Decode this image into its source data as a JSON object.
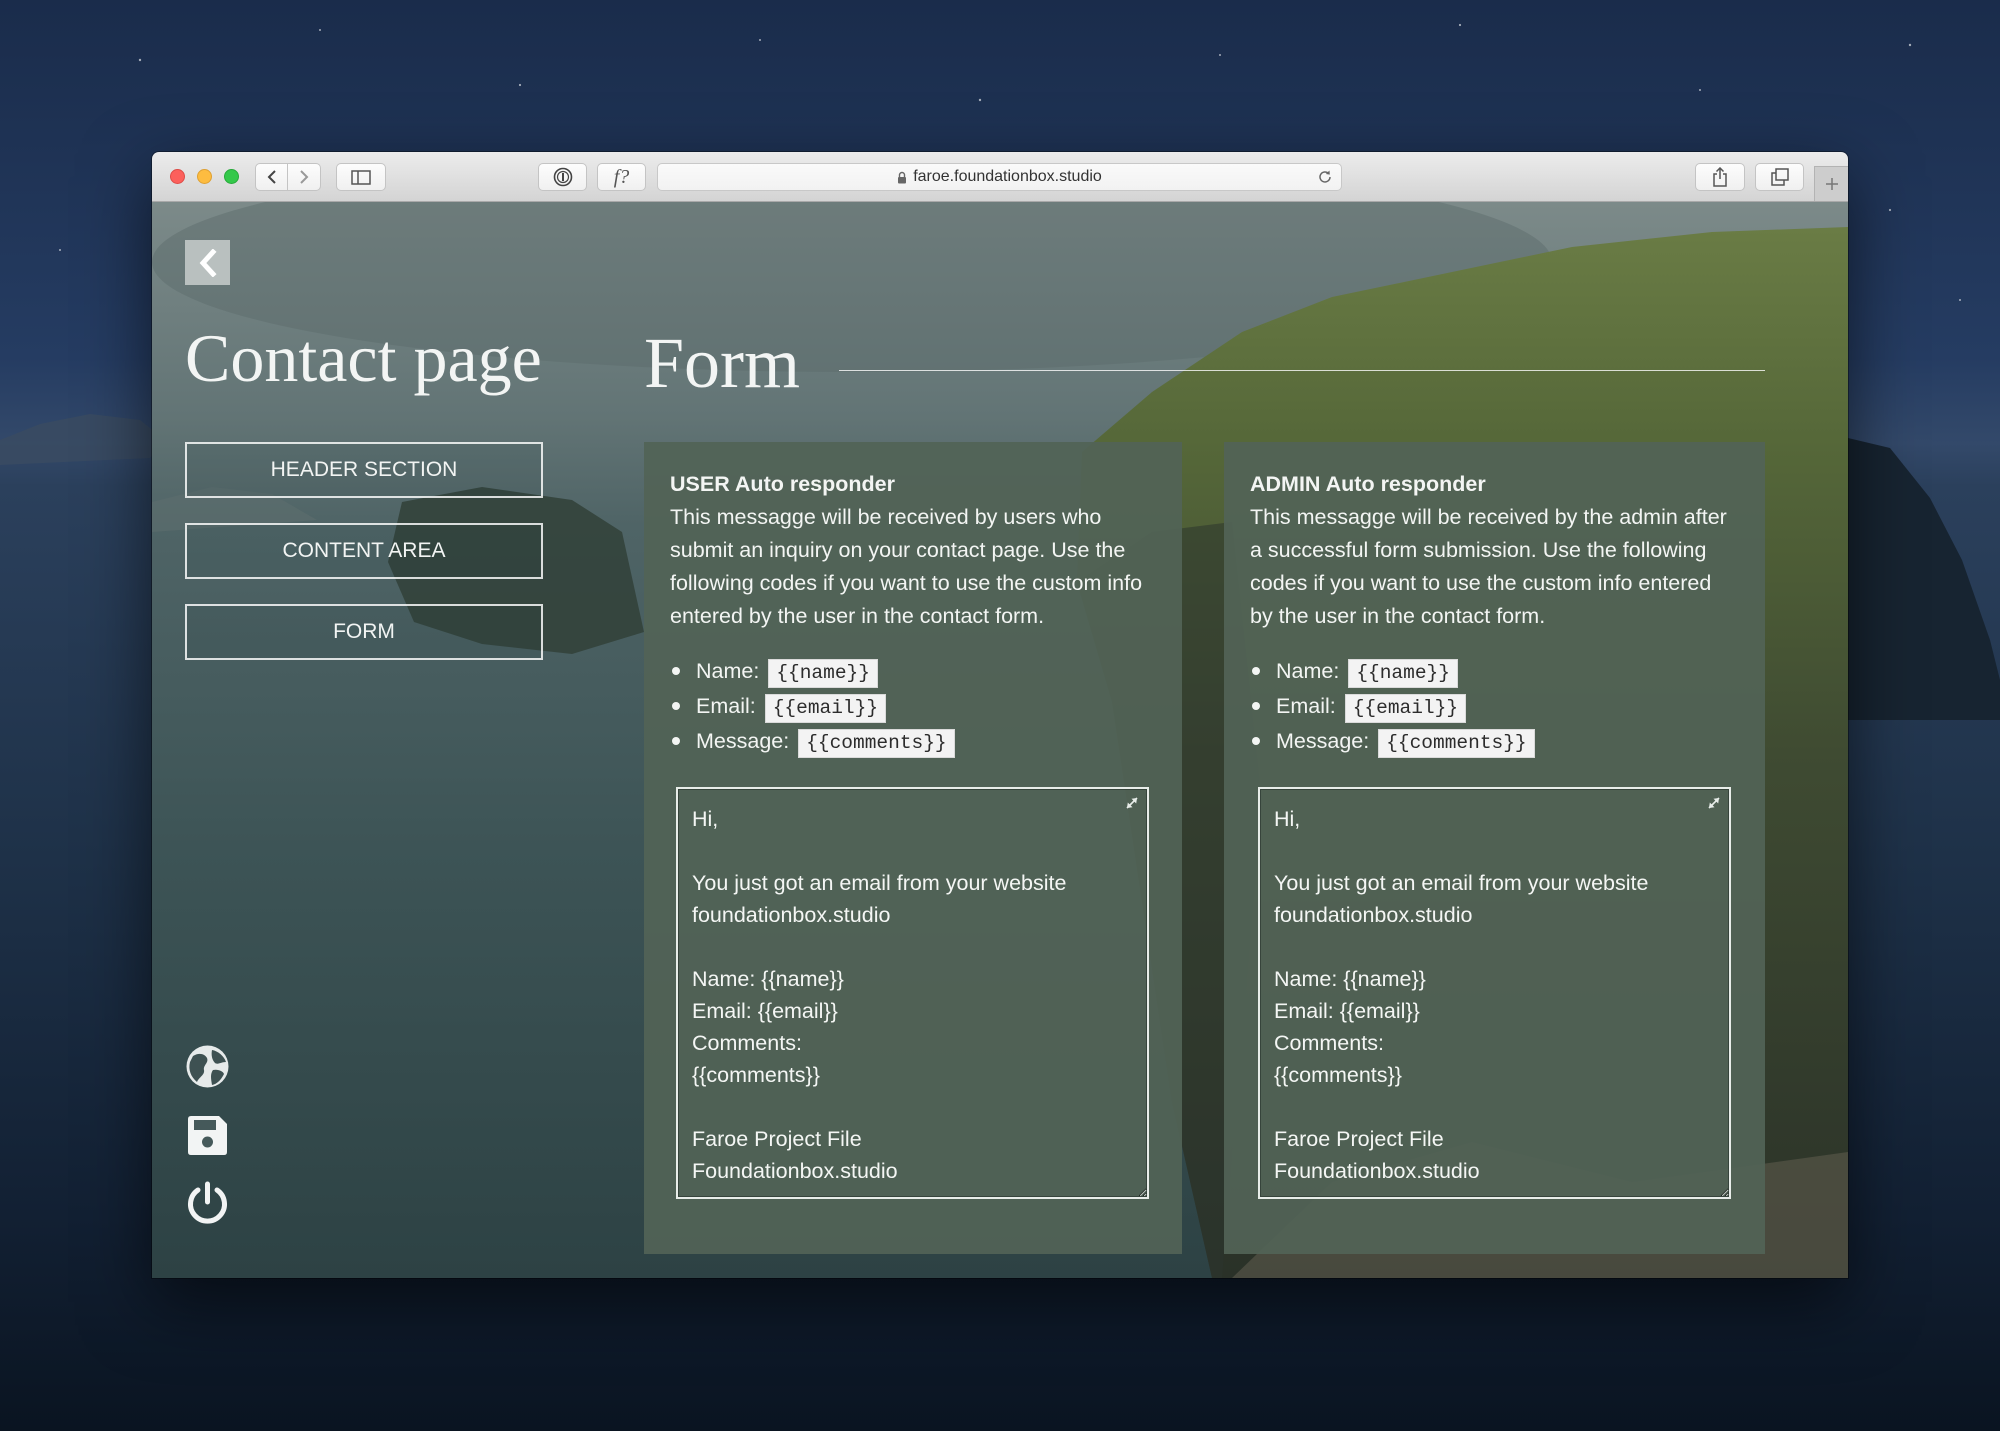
{
  "browser": {
    "url": "faroe.foundationbox.studio",
    "font_button_label": "f?",
    "traffic_light_colors": [
      "#fc605c",
      "#fdbc40",
      "#34c84a"
    ]
  },
  "sidebar": {
    "title": "Contact page",
    "nav": [
      "HEADER SECTION",
      "CONTENT AREA",
      "FORM"
    ]
  },
  "main": {
    "title": "Form",
    "panels": [
      {
        "title": "USER Auto responder",
        "description": "This messagge will be received by users who submit an inquiry on your contact page. Use the following codes if you want to use the custom info entered by the user in the contact form.",
        "codes": [
          {
            "label": "Name:",
            "code": "{{name}}"
          },
          {
            "label": "Email:",
            "code": "{{email}}"
          },
          {
            "label": "Message:",
            "code": "{{comments}}"
          }
        ],
        "message": "Hi,\n\nYou just got an email from your website foundationbox.studio\n\nName: {{name}}\nEmail: {{email}}\nComments:\n{{comments}}\n\nFaroe Project File\nFoundationbox.studio"
      },
      {
        "title": "ADMIN Auto responder",
        "description": "This messagge will be received by the admin after a successful form submission. Use the following codes if you want to use the custom info entered by the user in the contact form.",
        "codes": [
          {
            "label": "Name:",
            "code": "{{name}}"
          },
          {
            "label": "Email:",
            "code": "{{email}}"
          },
          {
            "label": "Message:",
            "code": "{{comments}}"
          }
        ],
        "message": "Hi,\n\nYou just got an email from your website foundationbox.studio\n\nName: {{name}}\nEmail: {{email}}\nComments:\n{{comments}}\n\nFaroe Project File\nFoundationbox.studio"
      }
    ]
  },
  "icons": {
    "back": "chevron-left-icon",
    "globe": "globe-icon",
    "save": "save-icon",
    "power": "power-icon",
    "lock": "lock-icon",
    "reload": "reload-icon",
    "share": "share-icon",
    "tabs": "tabs-icon",
    "expand": "expand-icon"
  },
  "colors": {
    "panel_background": "#536357",
    "text": "#f3f5f3",
    "code_background": "#f3f3f3"
  }
}
